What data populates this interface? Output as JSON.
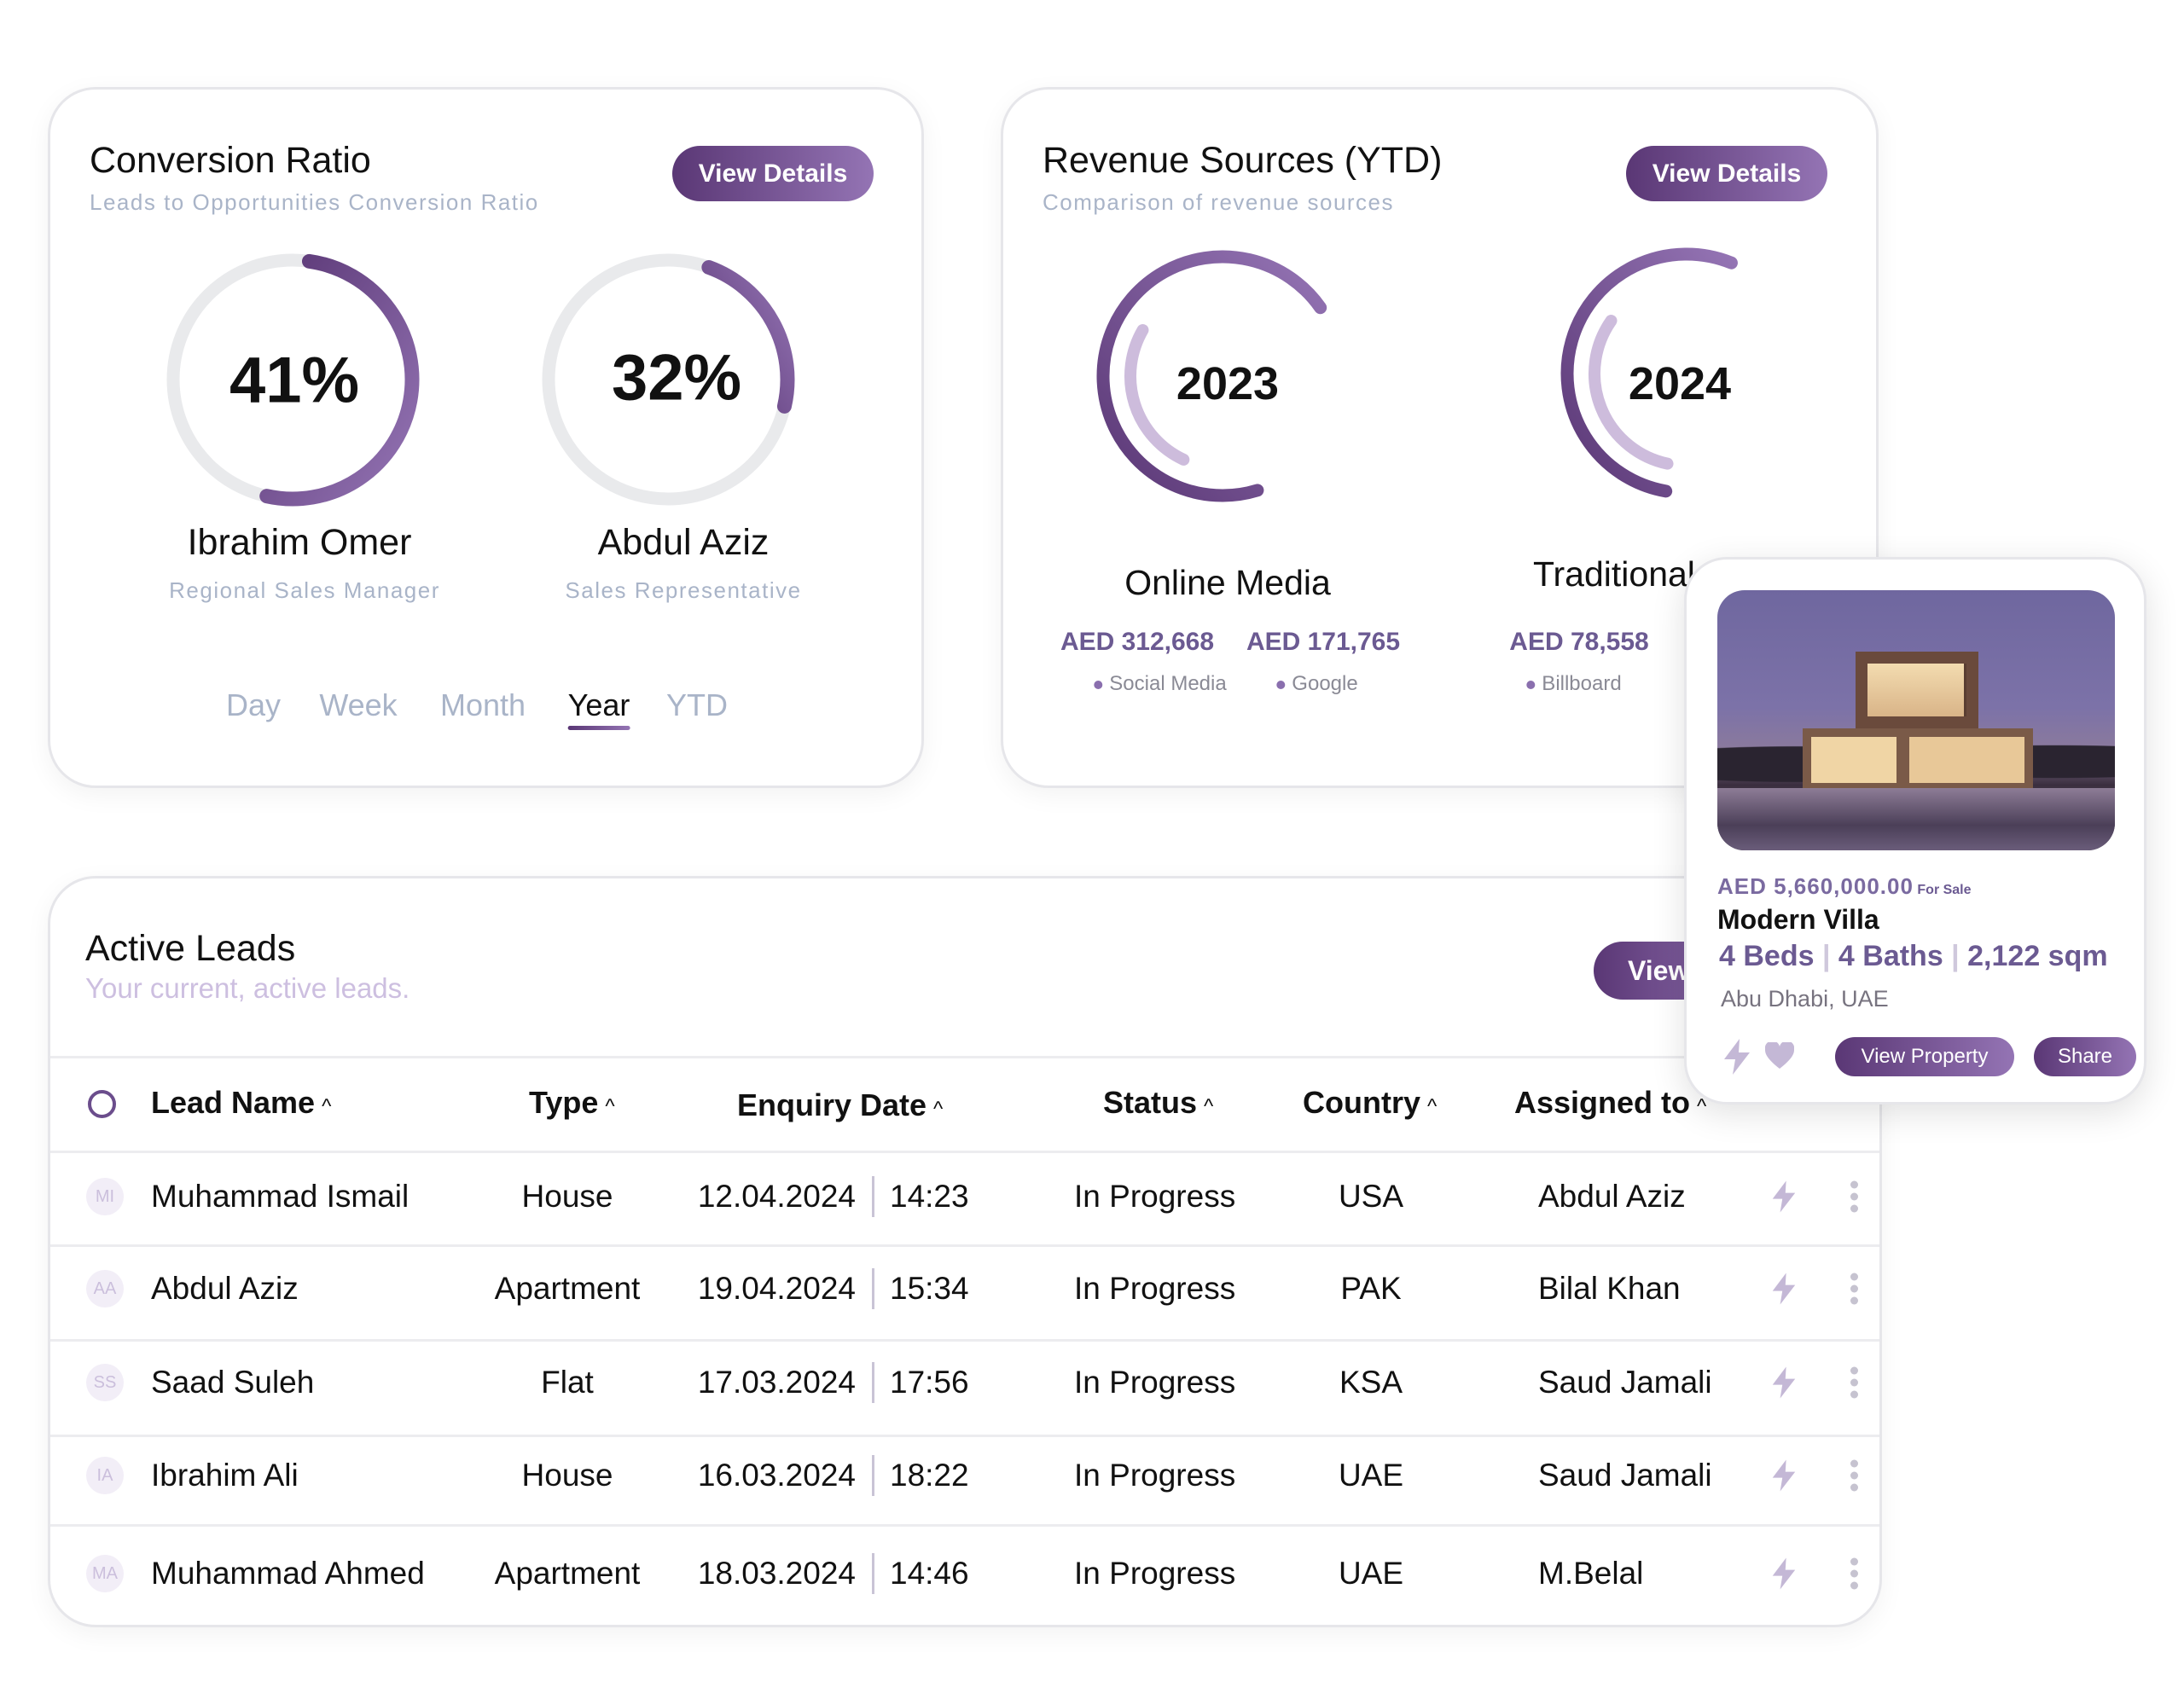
{
  "conversion": {
    "title": "Conversion Ratio",
    "subtitle": "Leads to Opportunities Conversion Ratio",
    "button": "View Details",
    "people": [
      {
        "percent": 41,
        "label": "41%",
        "name": "Ibrahim Omer",
        "role": "Regional Sales Manager"
      },
      {
        "percent": 32,
        "label": "32%",
        "name": "Abdul Aziz",
        "role": "Sales Representative"
      }
    ],
    "tabs": [
      "Day",
      "Week",
      "Month",
      "Year",
      "YTD"
    ],
    "active_tab": "Year"
  },
  "revenue": {
    "title": "Revenue Sources (YTD)",
    "subtitle": "Comparison of revenue sources",
    "button": "View Details",
    "years": [
      "2023",
      "2024"
    ],
    "groups": [
      {
        "name": "Online Media",
        "items": [
          {
            "amount": "AED 312,668",
            "source": "Social Media"
          },
          {
            "amount": "AED 171,765",
            "source": "Google"
          }
        ]
      },
      {
        "name": "Traditional",
        "items": [
          {
            "amount": "AED 78,558",
            "source": "Billboard"
          }
        ]
      }
    ]
  },
  "leads": {
    "title": "Active Leads",
    "subtitle": "Your current, active leads.",
    "button": "View",
    "columns": [
      "Lead Name",
      "Type",
      "Enquiry Date",
      "Status",
      "Country",
      "Assigned to"
    ],
    "rows": [
      {
        "initials": "MI",
        "name": "Muhammad Ismail",
        "type": "House",
        "date": "12.04.2024",
        "time": "14:23",
        "status": "In Progress",
        "country": "USA",
        "assigned": "Abdul Aziz"
      },
      {
        "initials": "AA",
        "name": "Abdul Aziz",
        "type": "Apartment",
        "date": "19.04.2024",
        "time": "15:34",
        "status": "In Progress",
        "country": "PAK",
        "assigned": "Bilal Khan"
      },
      {
        "initials": "SS",
        "name": "Saad Suleh",
        "type": "Flat",
        "date": "17.03.2024",
        "time": "17:56",
        "status": "In Progress",
        "country": "KSA",
        "assigned": "Saud Jamali"
      },
      {
        "initials": "IA",
        "name": "Ibrahim Ali",
        "type": "House",
        "date": "16.03.2024",
        "time": "18:22",
        "status": "In Progress",
        "country": "UAE",
        "assigned": "Saud Jamali"
      },
      {
        "initials": "MA",
        "name": "Muhammad Ahmed",
        "type": "Apartment",
        "date": "18.03.2024",
        "time": "14:46",
        "status": "In Progress",
        "country": "UAE",
        "assigned": "M.Belal"
      }
    ]
  },
  "property": {
    "price": "AED 5,660,000.00",
    "listing": "For Sale",
    "name": "Modern Villa",
    "beds": "4 Beds",
    "baths": "4 Baths",
    "area": "2,122 sqm",
    "location": "Abu Dhabi, UAE",
    "view_button": "View Property",
    "share_button": "Share",
    "icons": [
      "bolt-icon",
      "heart-icon"
    ]
  },
  "colors": {
    "accent_dark": "#5a3775",
    "accent_light": "#9474b4",
    "track": "#e9eaec",
    "muted": "#a9b4c8"
  }
}
